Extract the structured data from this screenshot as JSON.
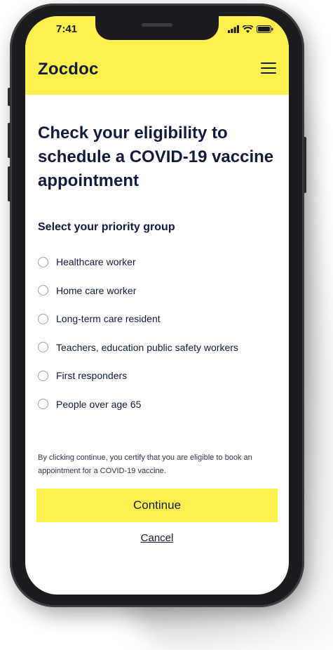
{
  "status_bar": {
    "time": "7:41",
    "icons": [
      "signal-icon",
      "wifi-icon",
      "battery-icon"
    ]
  },
  "header": {
    "brand": "Zocdoc",
    "menu_icon": "hamburger-menu-icon",
    "background_color": "#fff04e"
  },
  "main": {
    "title": "Check your eligibility to schedule a COVID-19 vaccine appointment",
    "priority_label": "Select your priority group",
    "options": [
      {
        "label": "Healthcare worker",
        "selected": false
      },
      {
        "label": "Home care worker",
        "selected": false
      },
      {
        "label": "Long-term care resident",
        "selected": false
      },
      {
        "label": "Teachers, education public safety workers",
        "selected": false
      },
      {
        "label": "First responders",
        "selected": false
      },
      {
        "label": "People over age 65",
        "selected": false
      }
    ],
    "disclaimer": "By clicking continue, you certify that you are eligible to book an appointment for a COVID-19 vaccine.",
    "continue_label": "Continue",
    "cancel_label": "Cancel"
  },
  "colors": {
    "accent": "#fff04e",
    "text_primary": "#101c3d",
    "phone_frame": "#1b1c1f"
  }
}
